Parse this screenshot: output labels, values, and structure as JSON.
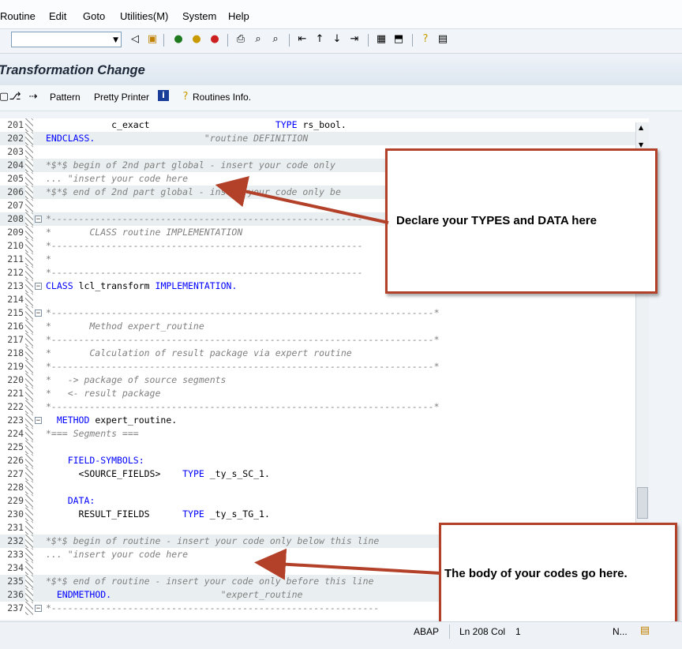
{
  "menu": [
    "Routine",
    "Edit",
    "Goto",
    "Utilities(M)",
    "System",
    "Help"
  ],
  "window_title": "Transformation Change",
  "app_toolbar": {
    "pattern": "Pattern",
    "pretty_printer": "Pretty Printer",
    "routines_info": "Routines Info."
  },
  "editor": {
    "lines": [
      {
        "num": "201",
        "code": "            c_exact                       TYPE rs_bool.",
        "style": "mixed201"
      },
      {
        "num": "202",
        "code": "ENDCLASS.                    \"routine DEFINITION",
        "style": "mixed202",
        "shade": true
      },
      {
        "num": "203",
        "code": "",
        "style": "plain"
      },
      {
        "num": "204",
        "code": "*$*$ begin of 2nd part global - insert your code only",
        "style": "comment",
        "shade": true
      },
      {
        "num": "205",
        "code": "... \"insert your code here",
        "style": "comment"
      },
      {
        "num": "206",
        "code": "*$*$ end of 2nd part global - insert your code only be",
        "style": "comment",
        "shade": true
      },
      {
        "num": "207",
        "code": "",
        "style": "plain"
      },
      {
        "num": "208",
        "code": "*---------------------------------------------------------",
        "style": "comment",
        "shade": true,
        "fold": true
      },
      {
        "num": "209",
        "code": "*       CLASS routine IMPLEMENTATION",
        "style": "comment"
      },
      {
        "num": "210",
        "code": "*---------------------------------------------------------",
        "style": "comment"
      },
      {
        "num": "211",
        "code": "*",
        "style": "comment"
      },
      {
        "num": "212",
        "code": "*---------------------------------------------------------",
        "style": "comment"
      },
      {
        "num": "213",
        "code": "CLASS lcl_transform IMPLEMENTATION.",
        "style": "mixed213",
        "fold": true
      },
      {
        "num": "214",
        "code": "",
        "style": "plain"
      },
      {
        "num": "215",
        "code": "*----------------------------------------------------------------------*",
        "style": "comment",
        "fold": true
      },
      {
        "num": "216",
        "code": "*       Method expert_routine",
        "style": "comment"
      },
      {
        "num": "217",
        "code": "*----------------------------------------------------------------------*",
        "style": "comment"
      },
      {
        "num": "218",
        "code": "*       Calculation of result package via expert routine",
        "style": "comment"
      },
      {
        "num": "219",
        "code": "*----------------------------------------------------------------------*",
        "style": "comment"
      },
      {
        "num": "220",
        "code": "*   -> package of source segments",
        "style": "comment"
      },
      {
        "num": "221",
        "code": "*   <- result package",
        "style": "comment"
      },
      {
        "num": "222",
        "code": "*----------------------------------------------------------------------*",
        "style": "comment"
      },
      {
        "num": "223",
        "code": "  METHOD expert_routine.",
        "style": "mixed223",
        "fold": true
      },
      {
        "num": "224",
        "code": "*=== Segments ===",
        "style": "comment"
      },
      {
        "num": "225",
        "code": "",
        "style": "plain"
      },
      {
        "num": "226",
        "code": "    FIELD-SYMBOLS:",
        "style": "keyword"
      },
      {
        "num": "227",
        "code": "      <SOURCE_FIELDS>    TYPE _ty_s_SC_1.",
        "style": "mixed227"
      },
      {
        "num": "228",
        "code": "",
        "style": "plain"
      },
      {
        "num": "229",
        "code": "    DATA:",
        "style": "keyword"
      },
      {
        "num": "230",
        "code": "      RESULT_FIELDS      TYPE _ty_s_TG_1.",
        "style": "mixed230"
      },
      {
        "num": "231",
        "code": "",
        "style": "plain"
      },
      {
        "num": "232",
        "code": "*$*$ begin of routine - insert your code only below this line",
        "style": "comment",
        "shade": true
      },
      {
        "num": "233",
        "code": "... \"insert your code here",
        "style": "comment"
      },
      {
        "num": "234",
        "code": "",
        "style": "plain"
      },
      {
        "num": "235",
        "code": "*$*$ end of routine - insert your code only before this line",
        "style": "comment",
        "shade": true
      },
      {
        "num": "236",
        "code": "  ENDMETHOD.                    \"expert_routine",
        "style": "mixed236",
        "shade": true
      },
      {
        "num": "237",
        "code": "*------------------------------------------------------------",
        "style": "comment",
        "fold": true
      }
    ]
  },
  "callouts": {
    "types_data": "Declare your TYPES and DATA here",
    "body": "The body of your codes go here."
  },
  "status": {
    "lang": "ABAP",
    "position": "Ln 208 Col",
    "col": "1",
    "mode": "N..."
  },
  "colors": {
    "arrow": "#b3412a",
    "keyword": "#0000ff",
    "comment": "#808080"
  }
}
